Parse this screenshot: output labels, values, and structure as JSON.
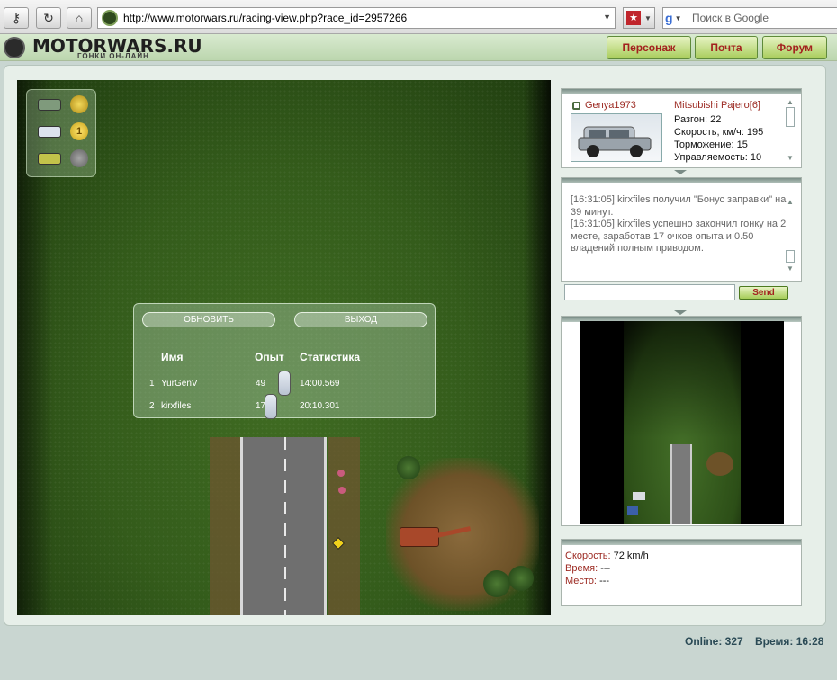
{
  "browser": {
    "url": "http://www.motorwars.ru/racing-view.php?race_id=2957266",
    "search_placeholder": "Поиск в Google"
  },
  "site": {
    "logo_text": "MOTORWARS.RU",
    "logo_sub": "ГОНКИ ОН-ЛАЙН",
    "nav": [
      "Персонаж",
      "Почта",
      "Форум"
    ]
  },
  "game": {
    "results": {
      "refresh_label": "ОБНОВИТЬ",
      "exit_label": "ВЫХОД",
      "headers": {
        "name": "Имя",
        "exp": "Опыт",
        "stats": "Статистика"
      },
      "rows": [
        {
          "place": "1",
          "name": "YurGenV",
          "exp": "49",
          "time": "14:00.569"
        },
        {
          "place": "2",
          "name": "kirxfiles",
          "exp": "17",
          "time": "20:10.301"
        }
      ]
    },
    "positions": [
      {
        "place": "",
        "car_color": "#7f9a7c",
        "coin_color": "#e4c14a"
      },
      {
        "place": "1",
        "car_color": "#dde3ee",
        "coin_color": "#f2d23a"
      },
      {
        "place": "",
        "car_color": "#c2c24a",
        "coin_color": "#8a8a8a"
      }
    ]
  },
  "player": {
    "name": "Genya1973",
    "car": "Mitsubishi Pajero[6]",
    "stats": [
      "Разгон: 22",
      "Скорость, км/ч: 195",
      "Торможение: 15",
      "Управляемость: 10"
    ]
  },
  "chat": {
    "messages": [
      "[16:31:05] kirxfiles получил \"Бонус заправки\" на 39 минут.",
      "[16:31:05] kirxfiles успешно закончил гонку на 2 месте, заработав 17 очков опыта и 0.50 владений полным приводом."
    ],
    "send_label": "Send"
  },
  "race_info": {
    "speed_label": "Скорость:",
    "speed_value": "72 km/h",
    "time_label": "Время:",
    "time_value": "---",
    "place_label": "Место:",
    "place_value": "---"
  },
  "footer": {
    "online": "Online: 327",
    "time": "Время: 16:28"
  }
}
